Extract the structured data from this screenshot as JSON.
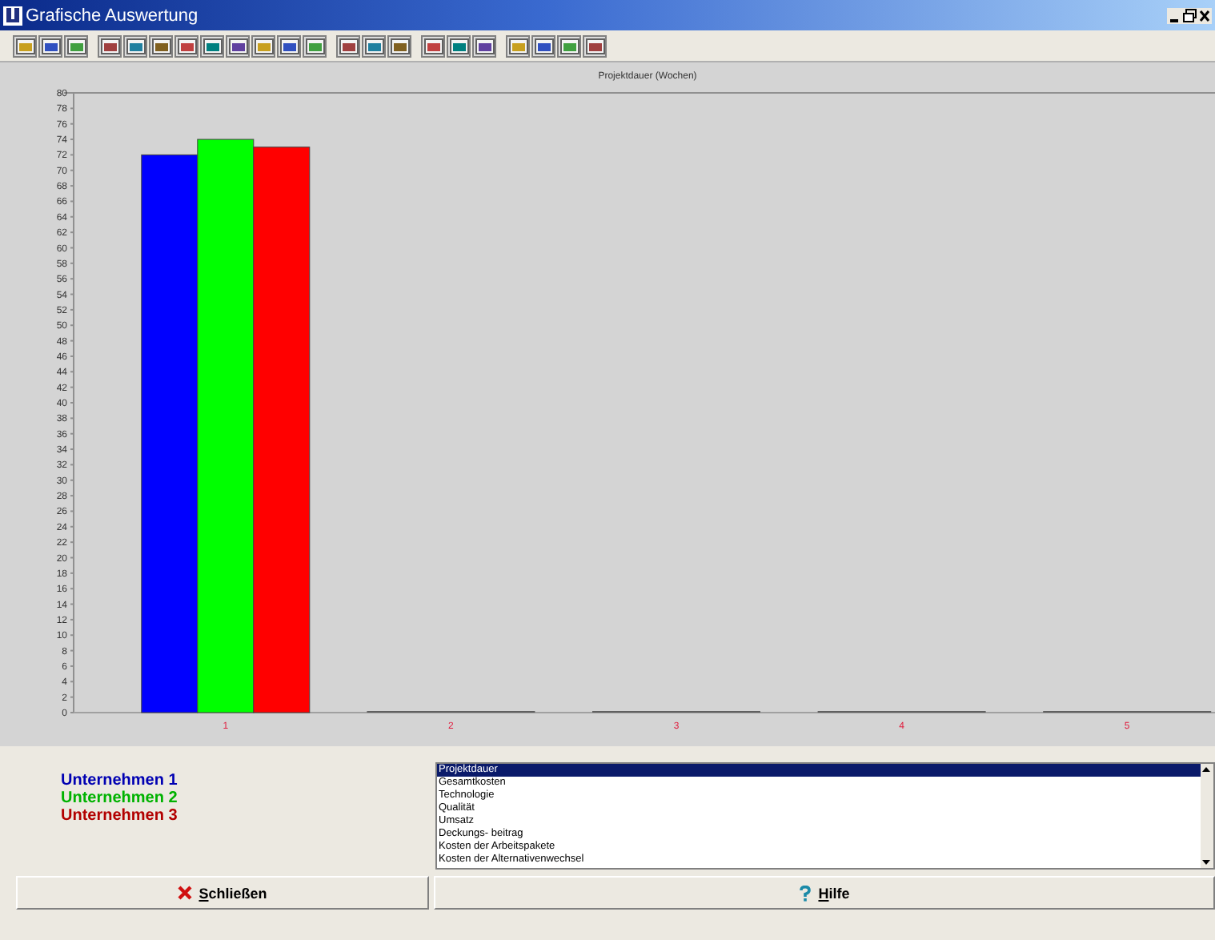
{
  "window": {
    "title": "Grafische Auswertung"
  },
  "chart_data": {
    "type": "bar",
    "title": "Projektdauer (Wochen)",
    "categories": [
      "1",
      "2",
      "3",
      "4",
      "5"
    ],
    "series": [
      {
        "name": "Unternehmen 1",
        "color": "#0000ff",
        "values": [
          72,
          0,
          0,
          0,
          0
        ]
      },
      {
        "name": "Unternehmen 2",
        "color": "#00ff00",
        "values": [
          74,
          0,
          0,
          0,
          0
        ]
      },
      {
        "name": "Unternehmen 3",
        "color": "#ff0000",
        "values": [
          73,
          0,
          0,
          0,
          0
        ]
      }
    ],
    "ylim": [
      0,
      80
    ],
    "yticks": [
      0,
      2,
      4,
      6,
      8,
      10,
      12,
      14,
      16,
      18,
      20,
      22,
      24,
      26,
      28,
      30,
      32,
      34,
      36,
      38,
      40,
      42,
      44,
      46,
      48,
      50,
      52,
      54,
      56,
      58,
      60,
      62,
      64,
      66,
      68,
      70,
      72,
      74,
      76,
      78,
      80
    ]
  },
  "criteria_list": {
    "items": [
      {
        "label": "Projektdauer",
        "selected": true
      },
      {
        "label": "Gesamtkosten",
        "selected": false
      },
      {
        "label": "Technologie",
        "selected": false
      },
      {
        "label": "Qualität",
        "selected": false
      },
      {
        "label": "Umsatz",
        "selected": false
      },
      {
        "label": "Deckungs- beitrag",
        "selected": false
      },
      {
        "label": "Kosten der Arbeitspakete",
        "selected": false
      },
      {
        "label": "Kosten der Alternativenwechsel",
        "selected": false
      }
    ]
  },
  "buttons": [
    {
      "label": "Schließen",
      "kind": "close"
    },
    {
      "label": "Hilfe",
      "kind": "help"
    }
  ]
}
